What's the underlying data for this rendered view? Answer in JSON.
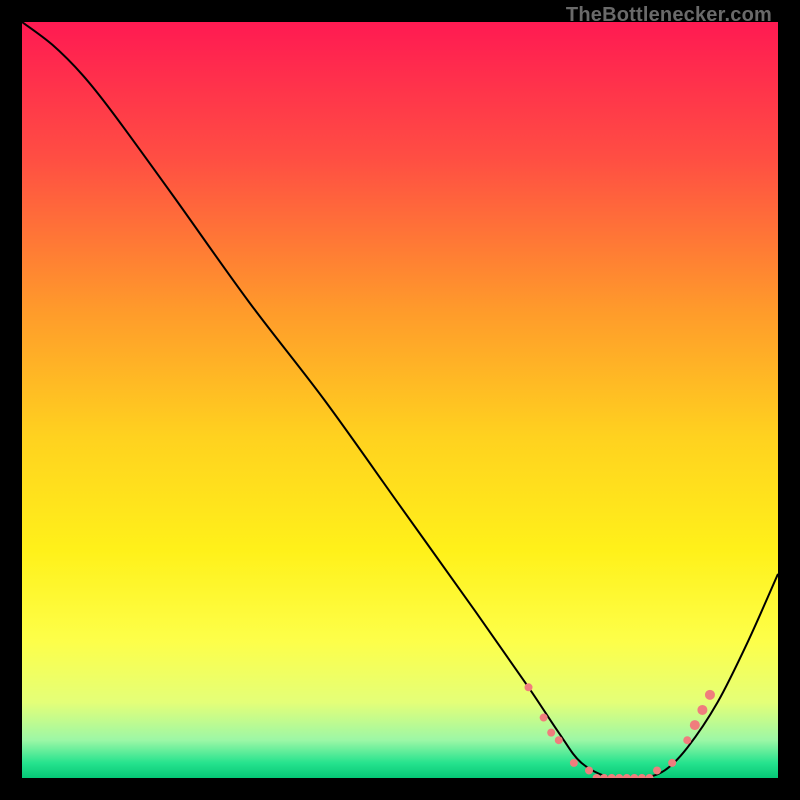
{
  "attribution": "TheBottlenecker.com",
  "chart_data": {
    "type": "line",
    "title": "",
    "xlabel": "",
    "ylabel": "",
    "xlim": [
      0,
      100
    ],
    "ylim": [
      0,
      100
    ],
    "grid": false,
    "background": "vertical-gradient",
    "gradient_stops": [
      {
        "pct": 0,
        "color": "#ff1a52"
      },
      {
        "pct": 18,
        "color": "#ff4e43"
      },
      {
        "pct": 38,
        "color": "#ff9a2b"
      },
      {
        "pct": 55,
        "color": "#ffd21f"
      },
      {
        "pct": 70,
        "color": "#fff11a"
      },
      {
        "pct": 82,
        "color": "#fdff4a"
      },
      {
        "pct": 90,
        "color": "#e4ff78"
      },
      {
        "pct": 95,
        "color": "#9cf7a6"
      },
      {
        "pct": 98,
        "color": "#26e38e"
      },
      {
        "pct": 100,
        "color": "#05c776"
      }
    ],
    "series": [
      {
        "name": "bottleneck-curve",
        "x": [
          0,
          4,
          8,
          12,
          20,
          30,
          40,
          50,
          60,
          67,
          71,
          74,
          78,
          82,
          85,
          88,
          92,
          96,
          100
        ],
        "y": [
          100,
          97,
          93,
          88,
          77,
          63,
          50,
          36,
          22,
          12,
          6,
          2,
          0,
          0,
          1,
          4,
          10,
          18,
          27
        ]
      }
    ],
    "markers": {
      "name": "highlighted-points",
      "color": "#f07d7d",
      "points": [
        {
          "x": 67,
          "y": 12,
          "r": 4
        },
        {
          "x": 69,
          "y": 8,
          "r": 4
        },
        {
          "x": 70,
          "y": 6,
          "r": 4
        },
        {
          "x": 71,
          "y": 5,
          "r": 4
        },
        {
          "x": 73,
          "y": 2,
          "r": 4
        },
        {
          "x": 75,
          "y": 1,
          "r": 4
        },
        {
          "x": 76,
          "y": 0,
          "r": 4
        },
        {
          "x": 77,
          "y": 0,
          "r": 4
        },
        {
          "x": 78,
          "y": 0,
          "r": 4
        },
        {
          "x": 79,
          "y": 0,
          "r": 4
        },
        {
          "x": 80,
          "y": 0,
          "r": 4
        },
        {
          "x": 81,
          "y": 0,
          "r": 4
        },
        {
          "x": 82,
          "y": 0,
          "r": 4
        },
        {
          "x": 83,
          "y": 0,
          "r": 4
        },
        {
          "x": 84,
          "y": 1,
          "r": 4
        },
        {
          "x": 86,
          "y": 2,
          "r": 4
        },
        {
          "x": 88,
          "y": 5,
          "r": 4
        },
        {
          "x": 89,
          "y": 7,
          "r": 5
        },
        {
          "x": 90,
          "y": 9,
          "r": 5
        },
        {
          "x": 91,
          "y": 11,
          "r": 5
        }
      ]
    }
  }
}
